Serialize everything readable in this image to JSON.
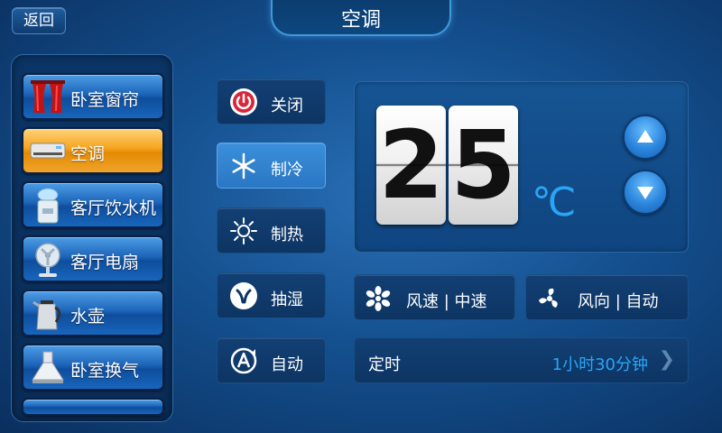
{
  "header": {
    "back_label": "返回",
    "title": "空调"
  },
  "sidebar": {
    "items": [
      {
        "label": "卧室窗帘",
        "icon": "curtain-icon",
        "active": false
      },
      {
        "label": "空调",
        "icon": "air-conditioner-icon",
        "active": true
      },
      {
        "label": "客厅饮水机",
        "icon": "water-dispenser-icon",
        "active": false
      },
      {
        "label": "客厅电扇",
        "icon": "electric-fan-icon",
        "active": false
      },
      {
        "label": "水壶",
        "icon": "kettle-icon",
        "active": false
      },
      {
        "label": "卧室换气",
        "icon": "range-hood-icon",
        "active": false
      }
    ]
  },
  "modes": [
    {
      "label": "关闭",
      "icon": "power-icon",
      "active": false
    },
    {
      "label": "制冷",
      "icon": "snowflake-icon",
      "active": true
    },
    {
      "label": "制热",
      "icon": "sun-icon",
      "active": false
    },
    {
      "label": "抽湿",
      "icon": "dehumidify-icon",
      "active": false
    },
    {
      "label": "自动",
      "icon": "auto-icon",
      "active": false
    }
  ],
  "temperature": {
    "digit_tens": "2",
    "digit_ones": "5",
    "unit": "℃",
    "up_icon": "triangle-up-icon",
    "down_icon": "triangle-down-icon"
  },
  "fan": {
    "speed_label": "风速 | 中速",
    "speed_icon": "fan-speed-icon",
    "direction_label": "风向 | 自动",
    "direction_icon": "fan-direction-icon"
  },
  "timer": {
    "label": "定时",
    "value": "1小时30分钟",
    "chevron_icon": "chevron-right-icon"
  },
  "colors": {
    "accent_blue": "#2aa5f5",
    "active_orange": "#f5a31c",
    "background_blue": "#14508f"
  }
}
